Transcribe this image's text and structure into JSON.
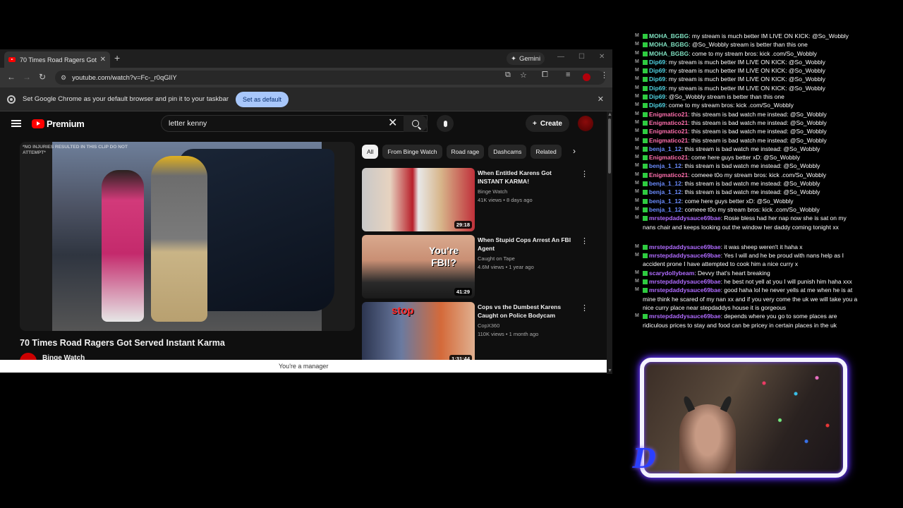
{
  "browser": {
    "tab_title": "70 Times Road Ragers Got Served",
    "tab_close": "✕",
    "new_tab": "+",
    "gemini_label": "Gemini",
    "url": "youtube.com/watch?v=Fc-_r0qGlIY",
    "infobar_text": "Set Google Chrome as your default browser and pin it to your taskbar",
    "set_default_label": "Set as default",
    "infobar_close": "✕"
  },
  "youtube": {
    "logo_text": "Premium",
    "search_value": "letter kenny",
    "create_label": "Create",
    "video_watermark": "*NO INJURIES RESULTED IN THIS CLIP DO NOT ATTEMPT*",
    "video_title": "70 Times Road Ragers Got Served Instant Karma",
    "channel_name": "Binge Watch",
    "chips": [
      "All",
      "From Binge Watch",
      "Road rage",
      "Dashcams",
      "Related"
    ],
    "recommendations": [
      {
        "title": "When Entitled Karens Got INSTANT KARMA!",
        "channel": "Binge Watch",
        "meta": "41K views • 8 days ago",
        "duration": "29:18",
        "thumb_text": ""
      },
      {
        "title": "When Stupid Cops Arrest An FBI Agent",
        "channel": "Caught on Tape",
        "meta": "4.6M views • 1 year ago",
        "duration": "41:29",
        "thumb_text": "You're FBI!?"
      },
      {
        "title": "Cops vs the Dumbest Karens Caught on Police Bodycam",
        "channel": "CopX360",
        "meta": "110K views • 1 month ago",
        "duration": "1:31:44",
        "thumb_text": "stop"
      }
    ],
    "status_text": "You're a manager"
  },
  "chat": {
    "messages": [
      {
        "user": "MOHA_BGBG",
        "color": "#7fe0c0",
        "text": ": my stream is much better IM LIVE ON KICK: @So_Wobbly"
      },
      {
        "user": "MOHA_BGBG",
        "color": "#7fe0c0",
        "text": ": @So_Wobbly stream is better than this one"
      },
      {
        "user": "MOHA_BGBG",
        "color": "#7fe0c0",
        "text": ": come to my stream bros: kick .com/So_Wobbly"
      },
      {
        "user": "Dip69",
        "color": "#4fd1e0",
        "text": ": my stream is much better IM LIVE ON KICK: @So_Wobbly"
      },
      {
        "user": "Dip69",
        "color": "#4fd1e0",
        "text": ": my stream is much better IM LIVE ON KICK: @So_Wobbly"
      },
      {
        "user": "Dip69",
        "color": "#4fd1e0",
        "text": ": my stream is much better IM LIVE ON KICK: @So_Wobbly"
      },
      {
        "user": "Dip69",
        "color": "#4fd1e0",
        "text": ": my stream is much better IM LIVE ON KICK: @So_Wobbly"
      },
      {
        "user": "Dip69",
        "color": "#4fd1e0",
        "text": ": @So_Wobbly stream is better than this one"
      },
      {
        "user": "Dip69",
        "color": "#4fd1e0",
        "text": ": come to my stream bros: kick .com/So_Wobbly"
      },
      {
        "user": "Enigmatico21",
        "color": "#ff6fae",
        "text": ": this stream is bad watch me instead: @So_Wobbly"
      },
      {
        "user": "Enigmatico21",
        "color": "#ff6fae",
        "text": ": this stream is bad watch me instead: @So_Wobbly"
      },
      {
        "user": "Enigmatico21",
        "color": "#ff6fae",
        "text": ": this stream is bad watch me instead: @So_Wobbly"
      },
      {
        "user": "Enigmatico21",
        "color": "#ff6fae",
        "text": ": this stream is bad watch me instead: @So_Wobbly"
      },
      {
        "user": "benja_1_12",
        "color": "#6b8cff",
        "text": ": this stream is bad watch me instead: @So_Wobbly"
      },
      {
        "user": "Enigmatico21",
        "color": "#ff6fae",
        "text": ": come here guys better xD: @So_Wobbly"
      },
      {
        "user": "benja_1_12",
        "color": "#6b8cff",
        "text": ": this stream is bad watch me instead: @So_Wobbly"
      },
      {
        "user": "Enigmatico21",
        "color": "#ff6fae",
        "text": ": comeee t0o my stream bros: kick .com/So_Wobbly"
      },
      {
        "user": "benja_1_12",
        "color": "#6b8cff",
        "text": ": this stream is bad watch me instead: @So_Wobbly"
      },
      {
        "user": "benja_1_12",
        "color": "#6b8cff",
        "text": ": this stream is bad watch me instead: @So_Wobbly"
      },
      {
        "user": "benja_1_12",
        "color": "#6b8cff",
        "text": ": come here guys better xD: @So_Wobbly"
      },
      {
        "user": "benja_1_12",
        "color": "#6b8cff",
        "text": ": comeee t0o my stream bros: kick .com/So_Wobbly"
      },
      {
        "user": "mrstepdaddysauce69bae",
        "color": "#b06bff",
        "text": ": Rosie bless had her nap now she is sat on my nans chair and keeps looking out the window her daddy coming tonight xx"
      },
      {
        "user": "mrstepdaddysauce69bae",
        "color": "#b06bff",
        "text": ": it was sheep weren't it haha x"
      },
      {
        "user": "mrstepdaddysauce69bae",
        "color": "#b06bff",
        "text": ": Yes I will and he be proud with nans help as I accident prone I have attempted to cook him a nice curry x"
      },
      {
        "user": "scarydollybeam",
        "color": "#b06bff",
        "text": ": Devvy that's heart breaking"
      },
      {
        "user": "mrstepdaddysauce69bae",
        "color": "#b06bff",
        "text": ": he best not yell at you I will punish him haha xxx"
      },
      {
        "user": "mrstepdaddysauce69bae",
        "color": "#b06bff",
        "text": ": good haha lol he never yells at me when he is at mine think he scared of my nan xx and if you very come the uk we will take you a nice curry place near stepdaddys house it is gorgeous"
      },
      {
        "user": "mrstepdaddysauce69bae",
        "color": "#b06bff",
        "text": ": depends where you go to some places are ridiculous prices to stay and food can be pricey in certain places in the uk"
      }
    ]
  },
  "webcam": {
    "logo_letter": "D"
  }
}
